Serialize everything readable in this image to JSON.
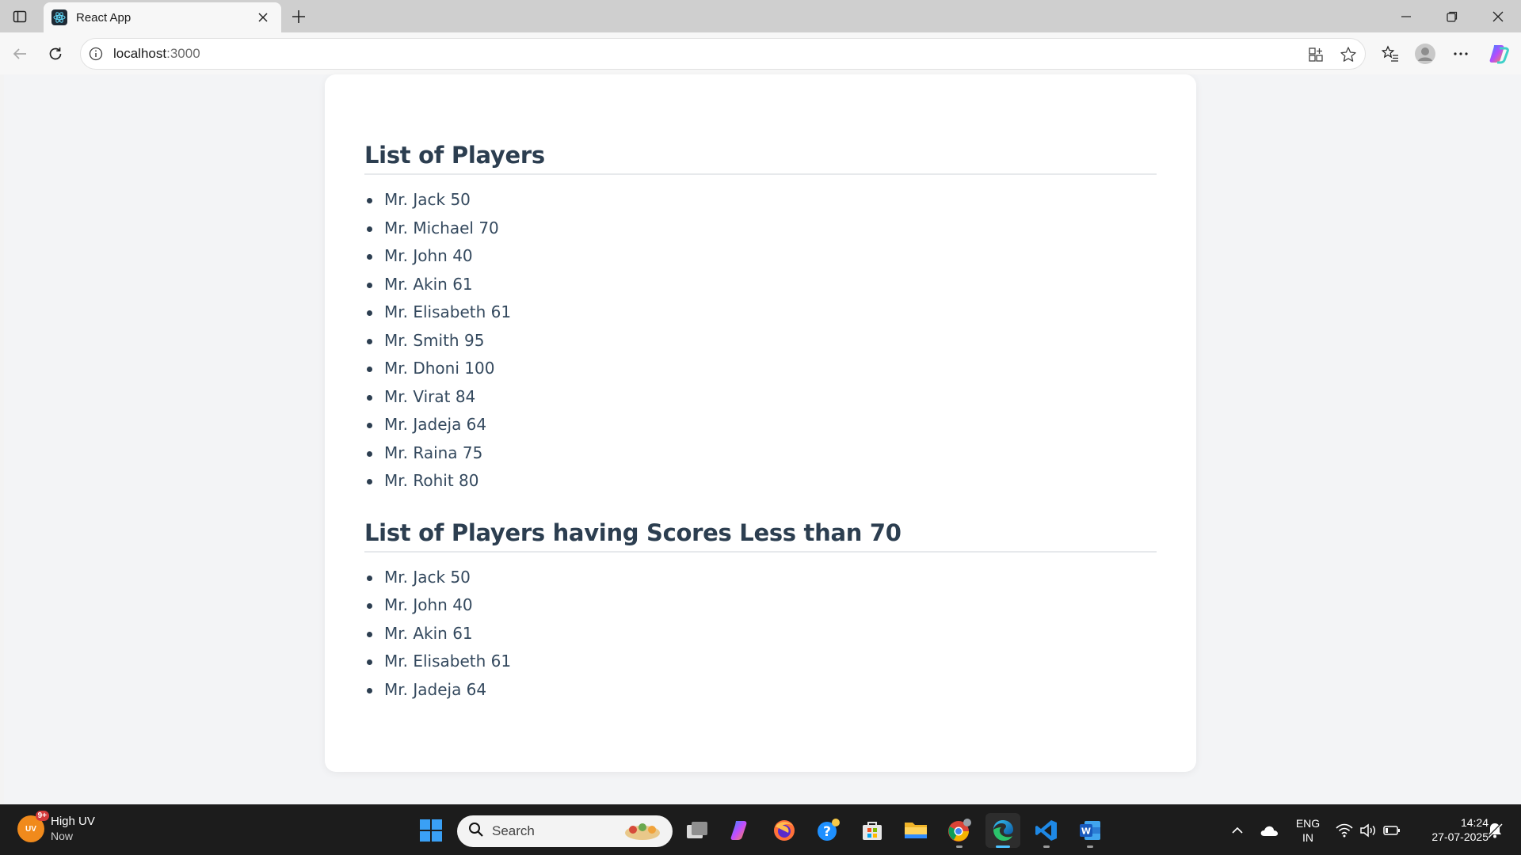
{
  "browser": {
    "tab_title": "React App",
    "url_prefix": "localhost",
    "url_suffix": ":3000"
  },
  "page": {
    "sections": [
      {
        "heading": "List of Players",
        "items": [
          "Mr. Jack 50",
          "Mr. Michael 70",
          "Mr. John 40",
          "Mr. Akin 61",
          "Mr. Elisabeth 61",
          "Mr. Smith 95",
          "Mr. Dhoni 100",
          "Mr. Virat 84",
          "Mr. Jadeja 64",
          "Mr. Raina 75",
          "Mr. Rohit 80"
        ]
      },
      {
        "heading": "List of Players having Scores Less than 70",
        "items": [
          "Mr. Jack 50",
          "Mr. John 40",
          "Mr. Akin 61",
          "Mr. Elisabeth 61",
          "Mr. Jadeja 64"
        ]
      }
    ]
  },
  "taskbar": {
    "weather_title": "High UV",
    "weather_sub": "Now",
    "weather_badge": "9+",
    "weather_icon_text": "UV",
    "search_label": "Search",
    "lang_top": "ENG",
    "lang_bottom": "IN",
    "time": "14:24",
    "date": "27-07-2025",
    "apps": [
      "start-icon",
      "task-view-icon",
      "copilot-icon",
      "firefox-icon",
      "help-icon",
      "store-icon",
      "file-explorer-icon",
      "chrome-icon",
      "edge-icon",
      "vscode-icon",
      "word-icon"
    ]
  },
  "colors": {
    "heading": "#2c3e50",
    "item_text": "#34495e",
    "page_bg": "#f3f4f6",
    "card_bg": "#ffffff",
    "taskbar_bg": "#1c1c1c",
    "active_indicator": "#4cc2ff"
  }
}
